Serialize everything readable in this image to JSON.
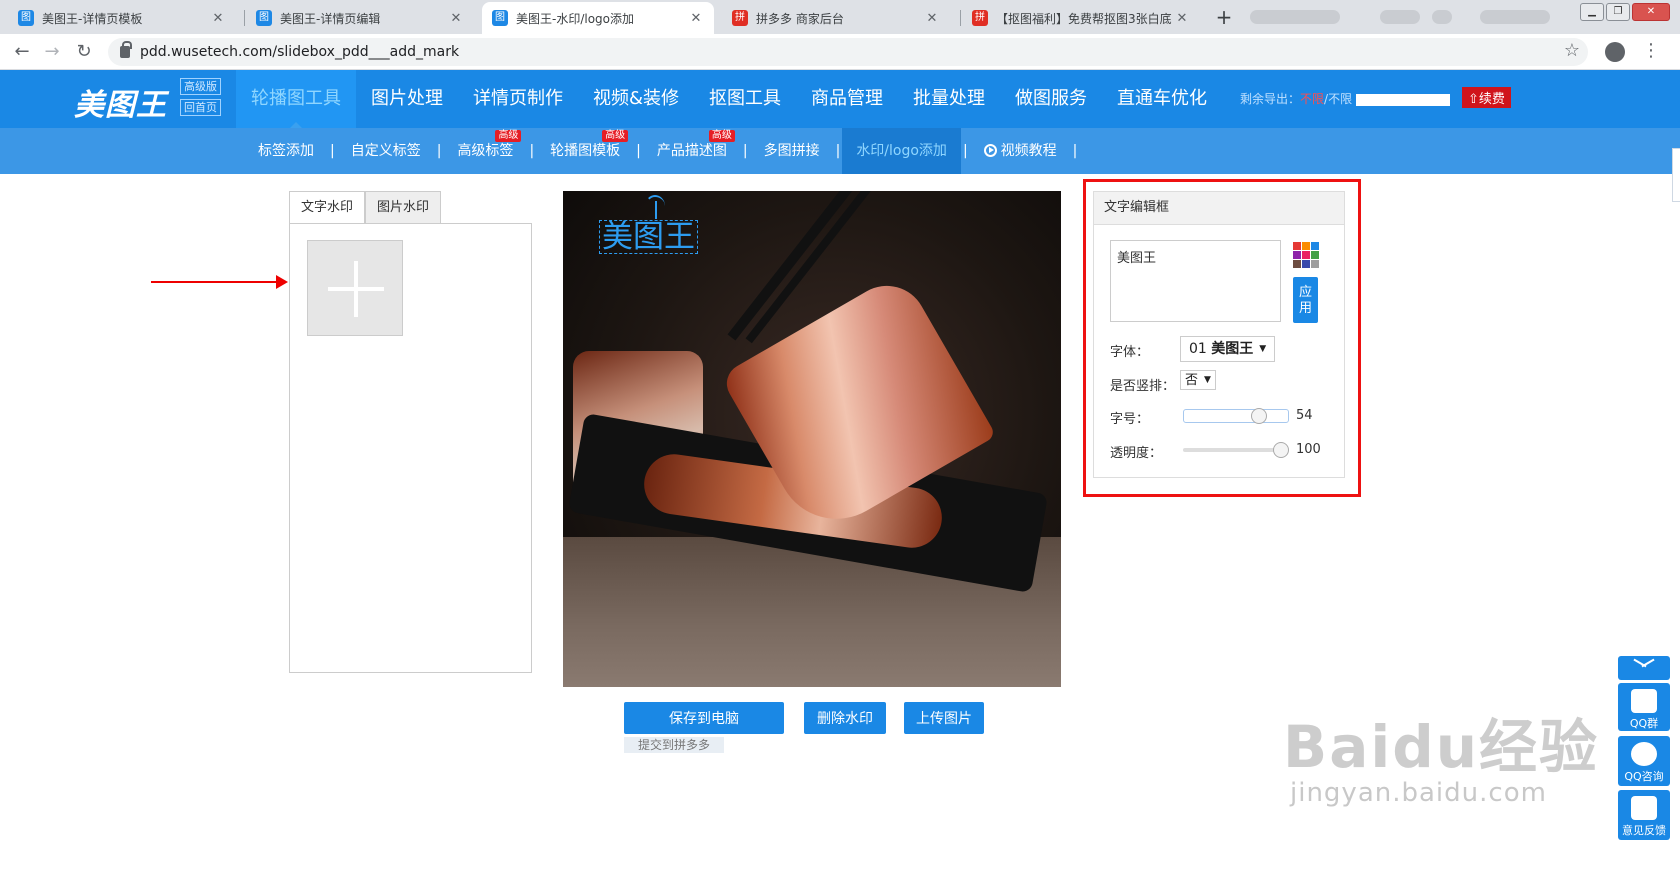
{
  "browser": {
    "tabs": [
      {
        "title": "美图王-详情页模板",
        "icon": "meitu-favicon",
        "active": false
      },
      {
        "title": "美图王-详情页编辑",
        "icon": "meitu-favicon",
        "active": false
      },
      {
        "title": "美图王-水印/logo添加",
        "icon": "meitu-favicon",
        "active": true
      },
      {
        "title": "拼多多 商家后台",
        "icon": "pdd-favicon",
        "active": false
      },
      {
        "title": "【抠图福利】免费帮抠图3张白底",
        "icon": "pdd-favicon",
        "active": false
      }
    ],
    "url": "pdd.wusetech.com/slidebox_pdd___add_mark"
  },
  "site": {
    "logo": "美图王",
    "logo_badges": [
      "高级版",
      "回首页"
    ],
    "main_nav": [
      "轮播图工具",
      "图片处理",
      "详情页制作",
      "视频&装修",
      "抠图工具",
      "商品管理",
      "批量处理",
      "做图服务",
      "直通车优化"
    ],
    "quota_label": "剩余导出：",
    "quota_unlimited": "不限",
    "quota_rest": "/不限",
    "renew": "续费",
    "sub_nav": [
      {
        "label": "标签添加",
        "badge": ""
      },
      {
        "label": "自定义标签",
        "badge": ""
      },
      {
        "label": "高级标签",
        "badge": "高级"
      },
      {
        "label": "轮播图模板",
        "badge": "高级"
      },
      {
        "label": "产品描述图",
        "badge": "高级"
      },
      {
        "label": "多图拼接",
        "badge": ""
      },
      {
        "label": "水印/logo添加",
        "badge": "",
        "active": true
      },
      {
        "label": "视频教程",
        "badge": "",
        "icon": "play-circle-icon"
      }
    ]
  },
  "left_panel": {
    "tabs": [
      "文字水印",
      "图片水印"
    ],
    "active_tab": "文字水印"
  },
  "canvas": {
    "watermark_text": "美图王"
  },
  "actions": {
    "save": "保存到电脑",
    "delete": "删除水印",
    "upload": "上传图片",
    "submit_hint": "提交到拼多多"
  },
  "editor": {
    "title": "文字编辑框",
    "text_value": "美图王",
    "apply": "应用",
    "font_label": "字体：",
    "font_prefix": "01",
    "font_value": "美图王",
    "vertical_label": "是否竖排：",
    "vertical_value": "否",
    "size_label": "字号：",
    "size_value": "54",
    "size_fraction": 0.77,
    "opacity_label": "透明度：",
    "opacity_value": "100",
    "opacity_fraction": 1.0,
    "palette_colors": [
      "#e53935",
      "#fb8c00",
      "#1e88e5",
      "#8e24aa",
      "#e91e63",
      "#43a047",
      "#6d4c41",
      "#3949ab",
      "#9e9e9e"
    ]
  },
  "float_buttons": [
    "QQ群",
    "QQ咨询",
    "意见反馈"
  ],
  "watermark_overlay": {
    "brand": "Baidu经验",
    "domain": "jingyan.baidu.com"
  }
}
